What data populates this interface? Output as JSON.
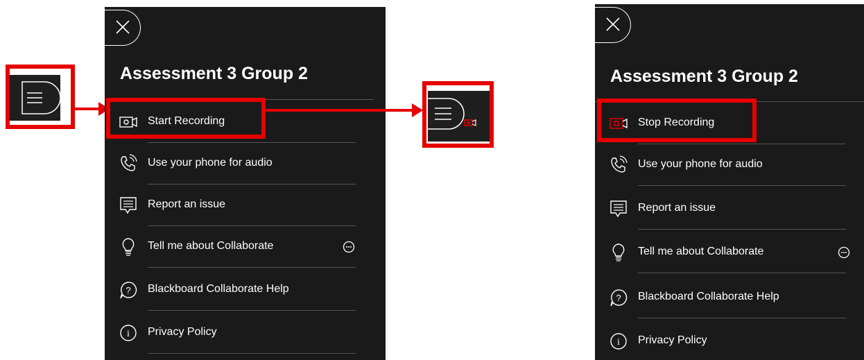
{
  "colors": {
    "panel_bg": "#1a1a1a",
    "highlight": "#e60000",
    "text": "#ffffff",
    "divider": "#555555"
  },
  "left_panel": {
    "title": "Assessment 3 Group 2",
    "items": [
      {
        "label": "Start Recording",
        "icon": "video-camera-icon"
      },
      {
        "label": "Use your phone for audio",
        "icon": "phone-icon"
      },
      {
        "label": "Report an issue",
        "icon": "report-issue-icon"
      },
      {
        "label": "Tell me about Collaborate",
        "icon": "lightbulb-icon"
      },
      {
        "label": "Blackboard Collaborate Help",
        "icon": "help-icon"
      },
      {
        "label": "Privacy Policy",
        "icon": "info-icon"
      }
    ]
  },
  "right_panel": {
    "title": "Assessment 3 Group 2",
    "items": [
      {
        "label": "Stop Recording",
        "icon": "video-camera-recording-icon"
      },
      {
        "label": "Use your phone for audio",
        "icon": "phone-icon"
      },
      {
        "label": "Report an issue",
        "icon": "report-issue-icon"
      },
      {
        "label": "Tell me about Collaborate",
        "icon": "lightbulb-icon"
      },
      {
        "label": "Blackboard Collaborate Help",
        "icon": "help-icon"
      },
      {
        "label": "Privacy Policy",
        "icon": "info-icon"
      }
    ]
  },
  "icons": {
    "close": "close-icon",
    "menu_toggle": "menu-lines-icon",
    "menu_recording": "menu-recording-indicator-icon",
    "more": "more-options-icon",
    "arrow": "arrow-right-icon"
  }
}
